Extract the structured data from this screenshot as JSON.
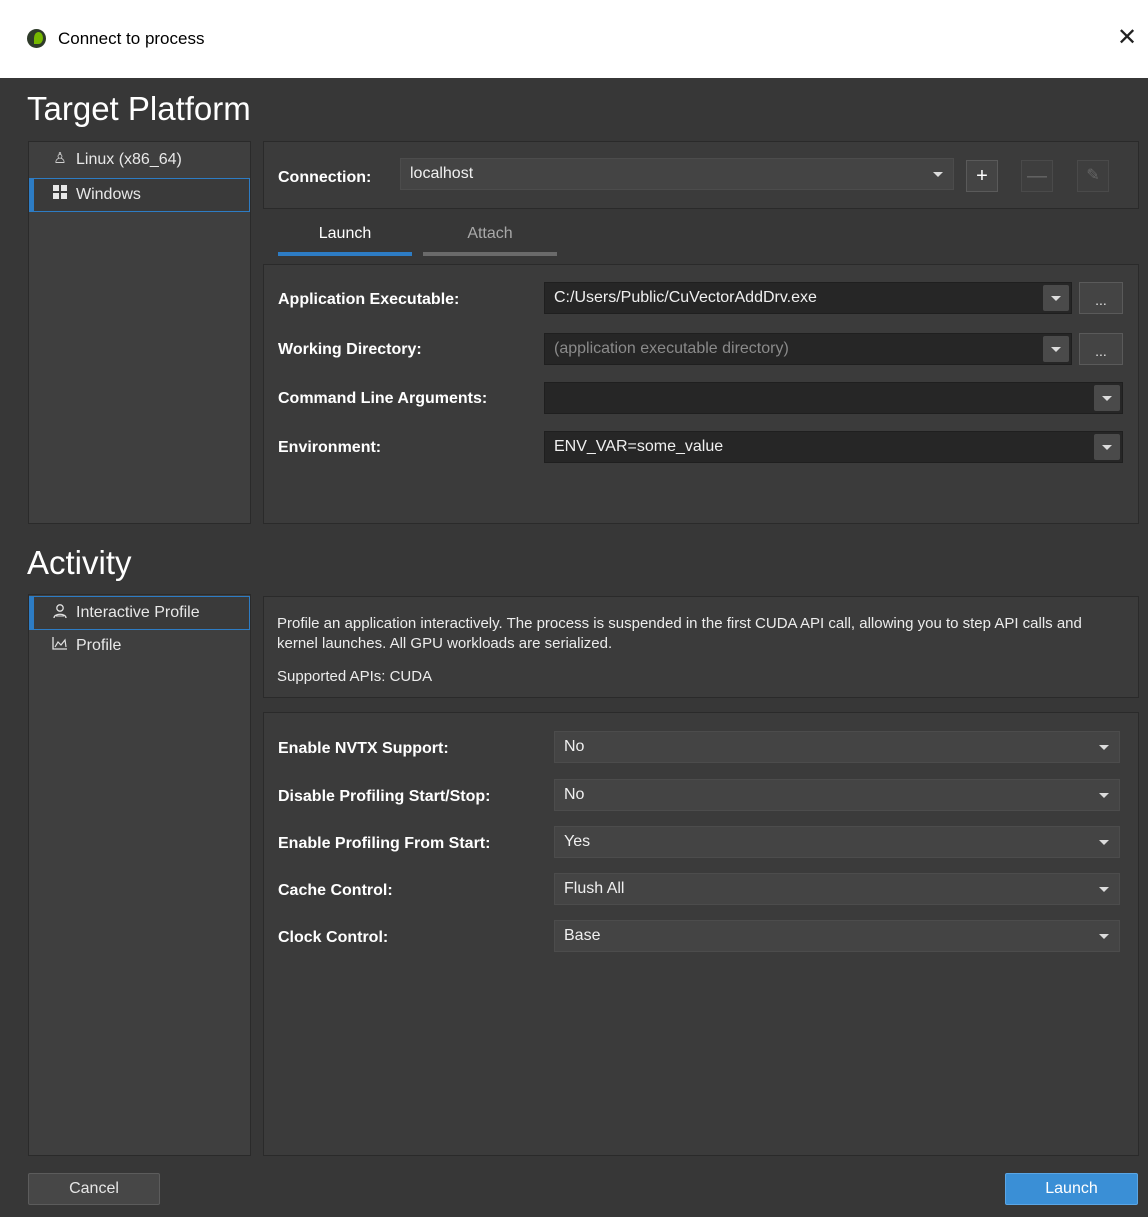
{
  "window": {
    "title": "Connect to process",
    "close_label": "✕"
  },
  "target_platform": {
    "heading": "Target Platform",
    "platforms": [
      {
        "label": "Linux (x86_64)",
        "icon": "linux-icon"
      },
      {
        "label": "Windows",
        "icon": "windows-icon",
        "selected": true
      }
    ]
  },
  "connection": {
    "label": "Connection:",
    "value": "localhost",
    "add_label": "+",
    "remove_label": "—",
    "edit_label": "✎"
  },
  "tabs": [
    {
      "label": "Launch",
      "active": true
    },
    {
      "label": "Attach",
      "active": false
    }
  ],
  "launch": {
    "app_exe_label": "Application Executable:",
    "app_exe_value": "C:/Users/Public/CuVectorAddDrv.exe",
    "work_dir_label": "Working Directory:",
    "work_dir_placeholder": "(application executable directory)",
    "cmd_args_label": "Command Line Arguments:",
    "cmd_args_value": "",
    "env_label": "Environment:",
    "env_value": "ENV_VAR=some_value",
    "browse_label": "..."
  },
  "activity": {
    "heading": "Activity",
    "items": [
      {
        "label": "Interactive Profile",
        "icon": "interactive-profile-icon",
        "selected": true
      },
      {
        "label": "Profile",
        "icon": "profile-chart-icon",
        "selected": false
      }
    ],
    "description": "Profile an application interactively. The process is suspended in the first CUDA API call, allowing you to step API calls and kernel launches. All GPU workloads are serialized.",
    "supported_apis": "Supported APIs: CUDA"
  },
  "options": [
    {
      "label": "Enable NVTX Support:",
      "value": "No"
    },
    {
      "label": "Disable Profiling Start/Stop:",
      "value": "No"
    },
    {
      "label": "Enable Profiling From Start:",
      "value": "Yes"
    },
    {
      "label": "Cache Control:",
      "value": "Flush All"
    },
    {
      "label": "Clock Control:",
      "value": "Base"
    }
  ],
  "footer": {
    "cancel_label": "Cancel",
    "launch_label": "Launch"
  },
  "colors": {
    "accent": "#2d7cc4",
    "launch_button": "#3a8fd6",
    "background": "#373737"
  }
}
